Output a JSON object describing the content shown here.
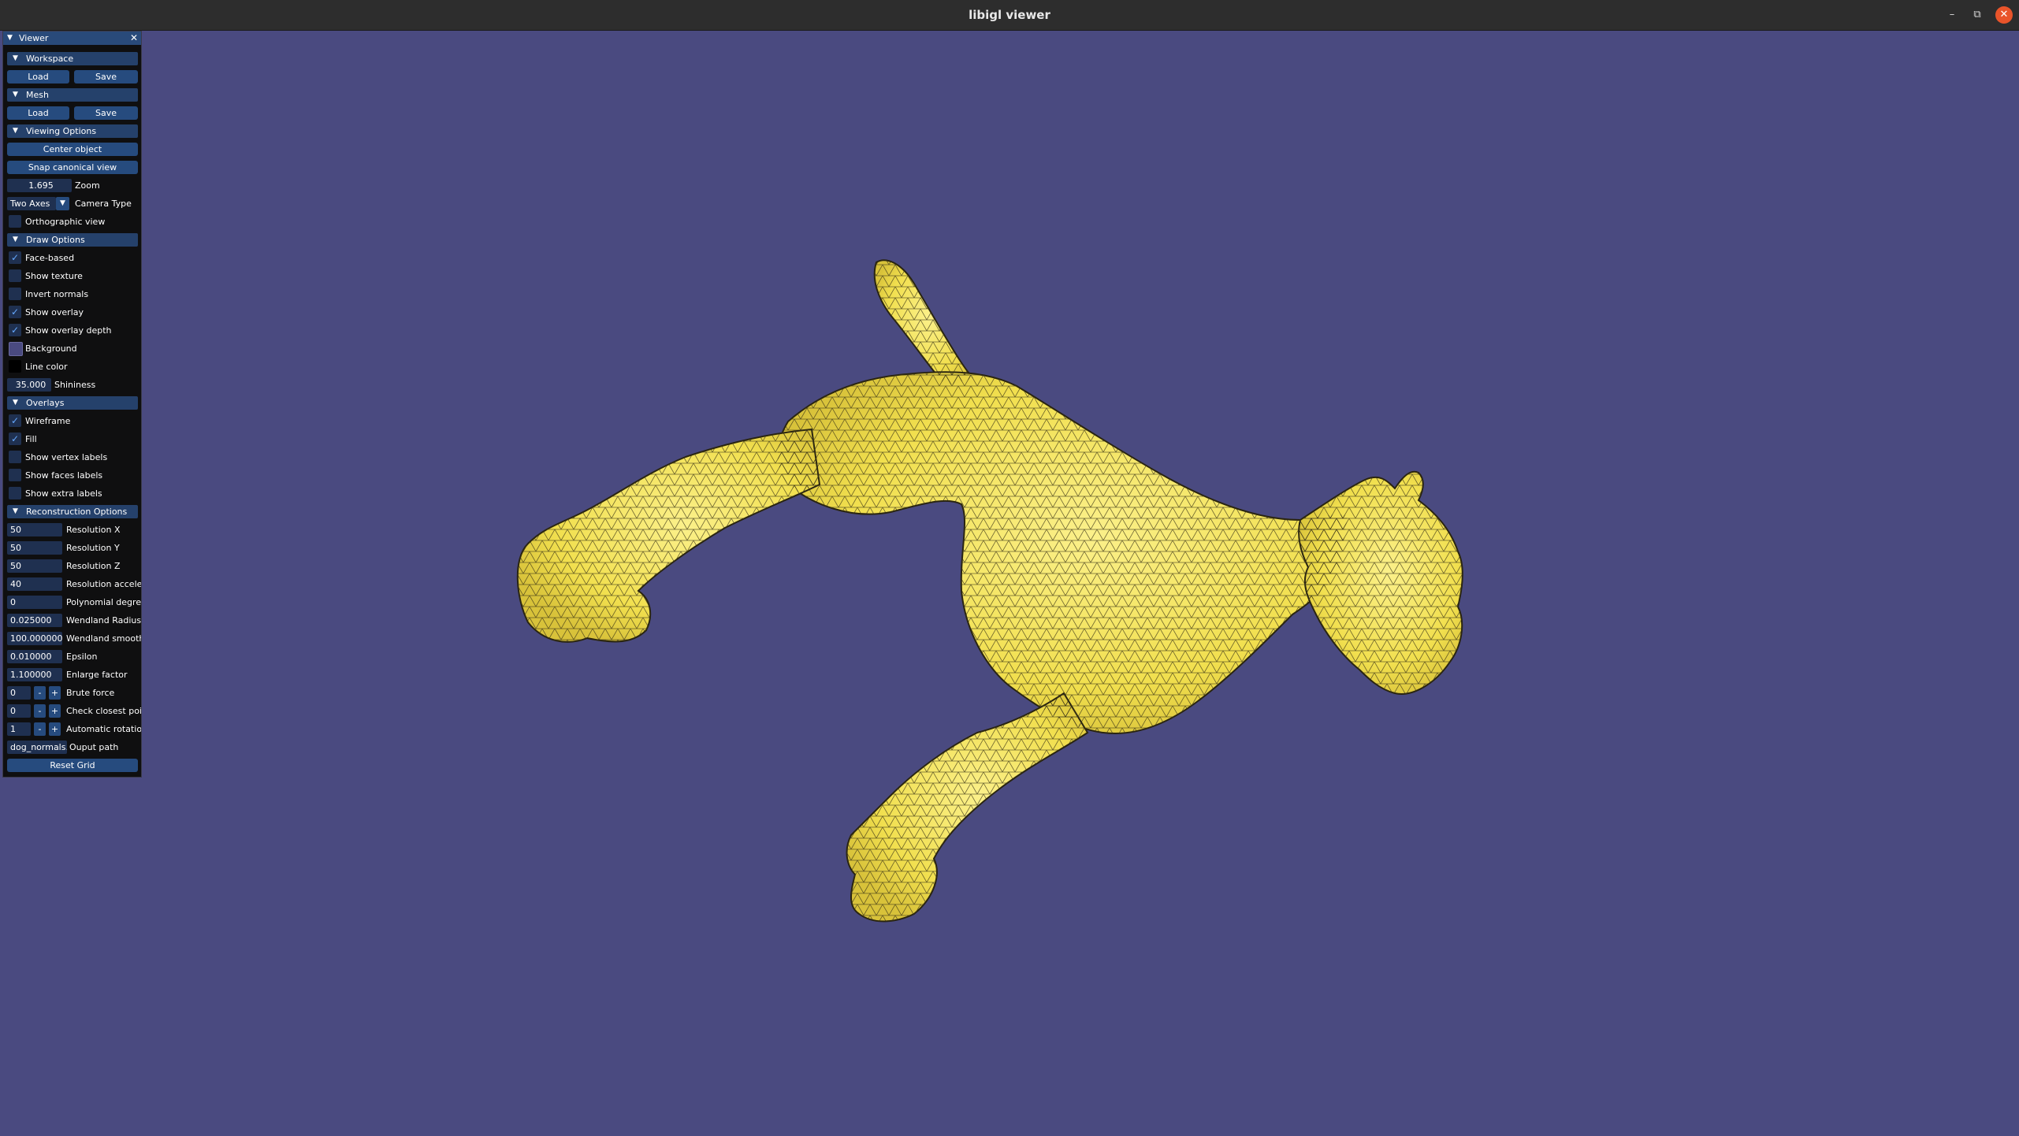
{
  "window": {
    "title": "libigl viewer",
    "minimize_icon": "–",
    "maximize_icon": "⧉",
    "close_icon": "✕"
  },
  "panel": {
    "title": "Viewer",
    "close_icon": "✕"
  },
  "workspace": {
    "header": "Workspace",
    "load": "Load",
    "save": "Save"
  },
  "mesh": {
    "header": "Mesh",
    "load": "Load",
    "save": "Save"
  },
  "viewing": {
    "header": "Viewing Options",
    "center_object": "Center object",
    "snap_canonical": "Snap canonical view",
    "zoom_value": "1.695",
    "zoom_label": "Zoom",
    "camera_value": "Two Axes",
    "camera_label": "Camera Type",
    "ortho_label": "Orthographic view"
  },
  "draw": {
    "header": "Draw Options",
    "face_based": "Face-based",
    "show_texture": "Show texture",
    "invert_normals": "Invert normals",
    "show_overlay": "Show overlay",
    "show_overlay_depth": "Show overlay depth",
    "background": "Background",
    "line_color": "Line color",
    "shininess_value": "35.000",
    "shininess_label": "Shininess",
    "background_color": "#4a4a80",
    "line_color_value": "#000000"
  },
  "overlays": {
    "header": "Overlays",
    "wireframe": "Wireframe",
    "fill": "Fill",
    "vertex_labels": "Show vertex labels",
    "faces_labels": "Show faces labels",
    "extra_labels": "Show extra labels"
  },
  "recon": {
    "header": "Reconstruction Options",
    "res_x_value": "50",
    "res_x_label": "Resolution X",
    "res_y_value": "50",
    "res_y_label": "Resolution Y",
    "res_z_value": "50",
    "res_z_label": "Resolution Z",
    "res_acc_value": "40",
    "res_acc_label": "Resolution acceler",
    "poly_value": "0",
    "poly_label": "Polynomial degree",
    "wend_r_value": "0.025000",
    "wend_r_label": "Wendland Radius",
    "wend_s_value": "100.000000",
    "wend_s_label": "Wendland smooth",
    "eps_value": "0.010000",
    "eps_label": "Epsilon",
    "enlarge_value": "1.100000",
    "enlarge_label": "Enlarge factor",
    "brute_value": "0",
    "brute_label": "Brute force",
    "closest_value": "0",
    "closest_label": "Check closest poin",
    "autorot_value": "1",
    "autorot_label": "Automatic rotatior",
    "output_value": "dog_normals.",
    "output_label": "Ouput path",
    "minus": "-",
    "plus": "+",
    "reset_grid": "Reset Grid"
  }
}
